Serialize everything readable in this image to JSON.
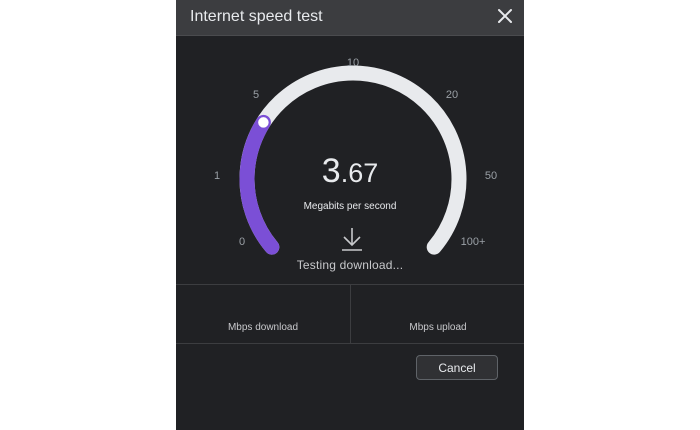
{
  "dialog": {
    "title": "Internet speed test",
    "close_icon": "close-icon"
  },
  "gauge": {
    "value_int": "3",
    "value_frac": ".67",
    "value": 3.67,
    "unit": "Megabits per second",
    "ticks": [
      "0",
      "1",
      "5",
      "10",
      "20",
      "50",
      "100+"
    ],
    "status": "Testing download...",
    "download_icon": "download-arrow-icon",
    "colors": {
      "track": "#e8eaed",
      "progress": "#7b4fd6",
      "thumb": "#ffffff"
    }
  },
  "results": {
    "download_label": "Mbps download",
    "upload_label": "Mbps upload"
  },
  "actions": {
    "cancel_label": "Cancel"
  }
}
